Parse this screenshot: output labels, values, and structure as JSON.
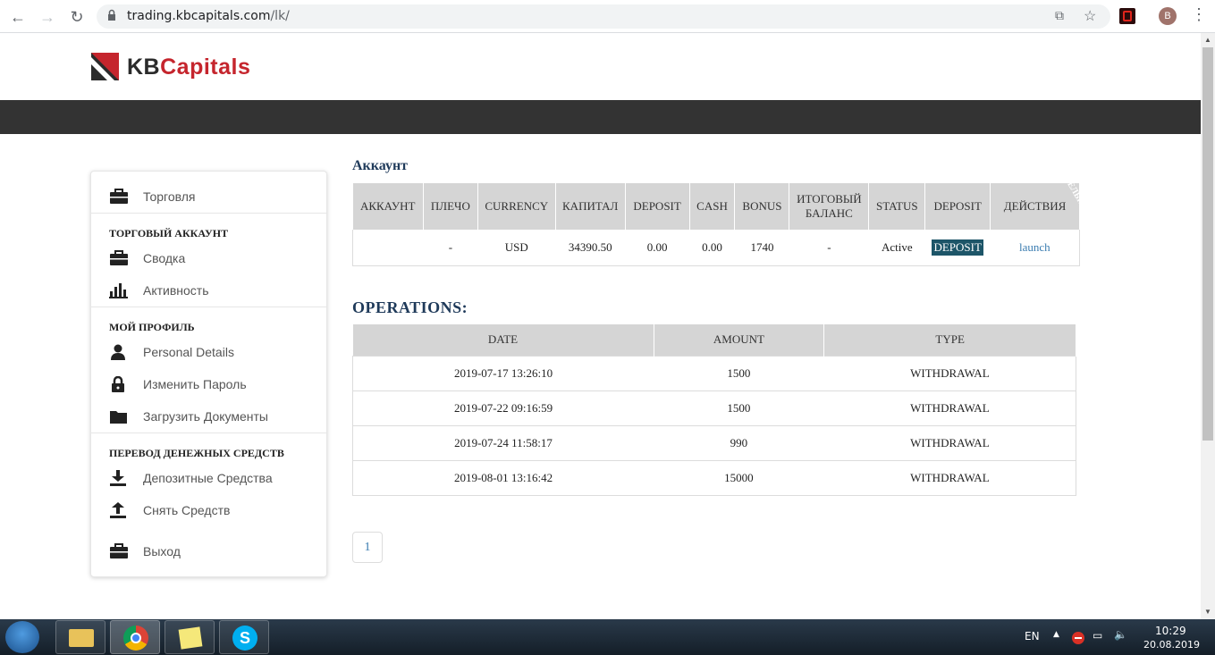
{
  "browser": {
    "url_host": "trading.kbcapitals.com",
    "url_path": "/lk/",
    "avatar_letter": "B"
  },
  "brand": {
    "name_part1": "KB",
    "name_part2": "Capitals",
    "accent_color": "#c5252d"
  },
  "sidebar": {
    "top_item": {
      "label": "Торговля",
      "icon": "briefcase-icon"
    },
    "sections": [
      {
        "heading": "ТОРГОВЫЙ АККАУНТ",
        "items": [
          {
            "label": "Сводка",
            "icon": "briefcase-icon"
          },
          {
            "label": "Активность",
            "icon": "bar-chart-icon"
          }
        ]
      },
      {
        "heading": "МОЙ ПРОФИЛЬ",
        "items": [
          {
            "label": "Personal Details",
            "icon": "user-icon"
          },
          {
            "label": "Изменить Пароль",
            "icon": "lock-icon"
          },
          {
            "label": "Загрузить Документы",
            "icon": "folder-icon"
          }
        ]
      },
      {
        "heading": "ПЕРЕВОД ДЕНЕЖНЫХ СРЕДСТВ",
        "items": [
          {
            "label": "Депозитные Средства",
            "icon": "download-icon"
          },
          {
            "label": "Снять Средств",
            "icon": "upload-icon"
          }
        ]
      }
    ],
    "logout": {
      "label": "Выход",
      "icon": "briefcase-icon"
    }
  },
  "account": {
    "title": "Аккаунт",
    "headers": [
      "АККАУНТ",
      "ПЛЕЧО",
      "CURRENCY",
      "КАПИТАЛ",
      "DEPOSIT",
      "CASH",
      "BONUS",
      "ИТОГОВЫЙ БАЛАНС",
      "STATUS",
      "DEPOSIT",
      "ДЕЙСТВИЯ"
    ],
    "header_overflow": "ЕЛЬН",
    "row": {
      "account": "",
      "leverage": "-",
      "currency": "USD",
      "capital": "34390.50",
      "deposit": "0.00",
      "cash": "0.00",
      "bonus": "1740",
      "total_balance": "-",
      "status": "Active",
      "deposit_button": "DEPOSIT",
      "action_link": "launch"
    }
  },
  "operations": {
    "title": "OPERATIONS:",
    "headers": [
      "DATE",
      "AMOUNT",
      "TYPE"
    ],
    "rows": [
      {
        "date": "2019-07-17 13:26:10",
        "amount": "1500",
        "type": "WITHDRAWAL"
      },
      {
        "date": "2019-07-22 09:16:59",
        "amount": "1500",
        "type": "WITHDRAWAL"
      },
      {
        "date": "2019-07-24 11:58:17",
        "amount": "990",
        "type": "WITHDRAWAL"
      },
      {
        "date": "2019-08-01 13:16:42",
        "amount": "15000",
        "type": "WITHDRAWAL"
      }
    ]
  },
  "pagination": {
    "current_page": "1"
  },
  "taskbar": {
    "language": "EN",
    "time": "10:29",
    "date": "20.08.2019"
  }
}
